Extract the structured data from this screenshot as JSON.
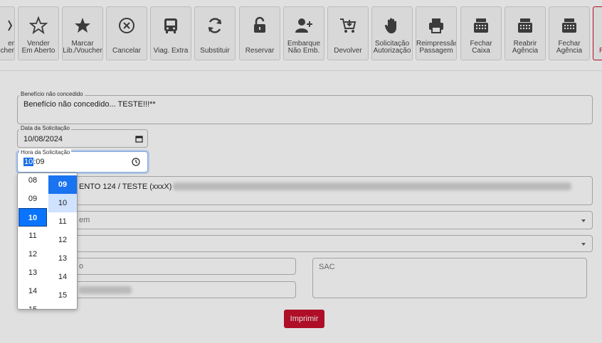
{
  "toolbar": {
    "buttons": [
      {
        "label": "er\nucher",
        "icon": "voucher-icon"
      },
      {
        "label": "Vender\nEm Aberto",
        "icon": "star-outline-icon"
      },
      {
        "label": "Marcar\nLib./Voucher",
        "icon": "star-filled-icon"
      },
      {
        "label": "Cancelar",
        "icon": "cancel-circle-icon"
      },
      {
        "label": "Viag. Extra",
        "icon": "bus-icon"
      },
      {
        "label": "Substituir",
        "icon": "refresh-icon"
      },
      {
        "label": "Reservar",
        "icon": "unlock-icon"
      },
      {
        "label": "Embarque\nNão Emb.",
        "icon": "user-plus-icon"
      },
      {
        "label": "Devolver",
        "icon": "cart-download-icon"
      },
      {
        "label": "Solicitação\nAutorização",
        "icon": "hand-icon"
      },
      {
        "label": "Reimpressão\nPassagem",
        "icon": "printer-icon"
      },
      {
        "label": "Fechar\nCaixa",
        "icon": "cash-register-icon"
      },
      {
        "label": "Reabrir\nAgência",
        "icon": "cash-register-icon"
      },
      {
        "label": "Fechar\nAgência",
        "icon": "cash-register-icon"
      },
      {
        "label": "R",
        "icon": ""
      }
    ]
  },
  "form": {
    "beneficio": {
      "label": "Benefício não concedido",
      "value": "Benefício não concedido... TESTE!!!**"
    },
    "data": {
      "label": "Data da Solicitação",
      "value": "10/08/2024"
    },
    "hora": {
      "label": "Hora da Solicitação",
      "hour": "10",
      "minute": ":09"
    },
    "viagem": {
      "value": "ENTO 124 / TESTE (xxxX) -"
    },
    "select1": {
      "placeholder": "em"
    },
    "field_left1": {
      "placeholder": "o"
    },
    "sac": {
      "placeholder": "SAC"
    },
    "print_label": "Imprimir"
  },
  "picker": {
    "hours": [
      "08",
      "09",
      "10",
      "11",
      "12",
      "13",
      "14",
      "15"
    ],
    "minutes": [
      "09",
      "10",
      "11",
      "12",
      "13",
      "14",
      "15"
    ],
    "selected_hour": "10",
    "selected_minute": "09",
    "hovered_minute": "10"
  },
  "colors": {
    "accent": "#c8102e",
    "picker_selected": "#0a74ff"
  }
}
